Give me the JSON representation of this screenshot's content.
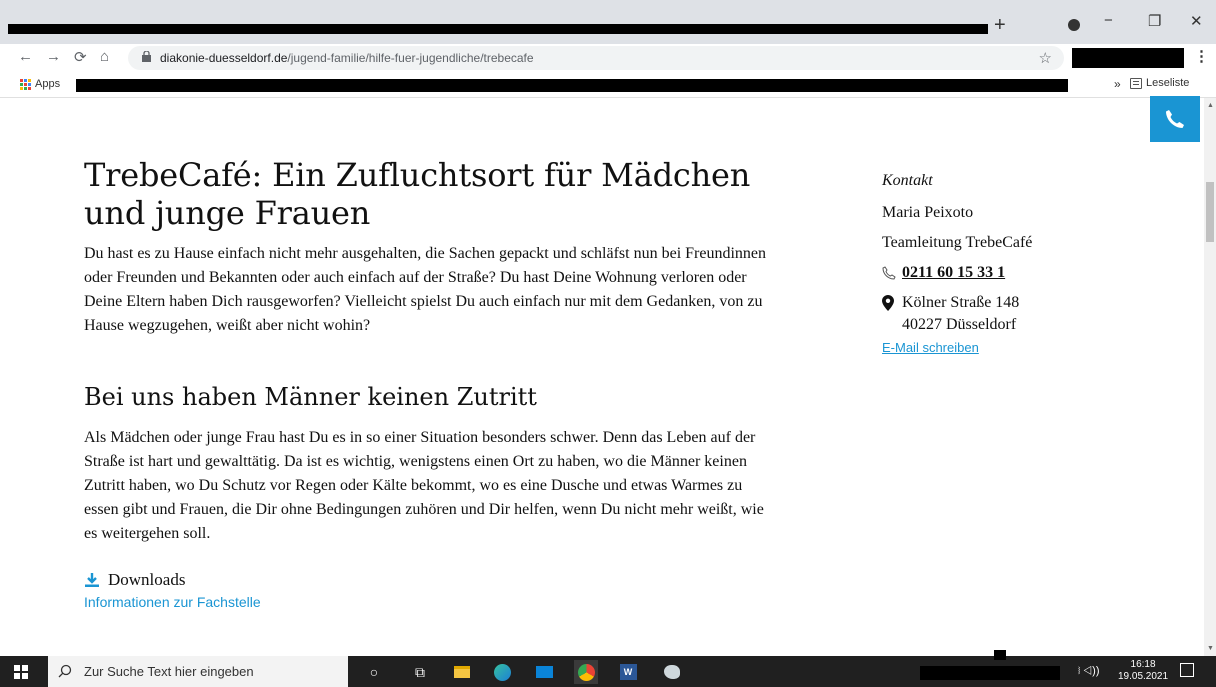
{
  "browser": {
    "new_tab_symbol": "+",
    "minimize_symbol": "−",
    "restore_symbol": "❐",
    "close_symbol": "✕",
    "url_domain": "diakonie-duesseldorf.de",
    "url_path": "/jugend-familie/hilfe-fuer-jugendliche/trebecafe",
    "bookmarks_apps_label": "Apps",
    "bookmarks_more": "»",
    "reading_list_label": "Leseliste"
  },
  "page": {
    "title": "TrebeCafé: Ein Zufluchtsort für Mädchen und junge Frauen",
    "intro": "Du hast es zu  Hause einfach nicht mehr ausgehalten, die Sachen gepackt und schläfst nun bei Freundinnen oder Freunden und Bekannten oder auch einfach auf der Straße? Du hast Deine Wohnung verloren oder Deine Eltern haben Dich rausgeworfen? Vielleicht spielst Du auch einfach nur mit dem Gedanken, von zu Hause wegzugehen, weißt aber nicht wohin?",
    "subheading": "Bei uns haben Männer keinen Zutritt",
    "paragraph2": "Als Mädchen oder junge Frau hast Du es in so einer Situation besonders schwer. Denn das Leben auf der Straße ist hart und gewalttätig. Da ist es wichtig, wenigstens einen Ort zu haben, wo die Männer keinen Zutritt haben, wo Du Schutz vor Regen oder Kälte bekommt, wo es eine Dusche und etwas Warmes zu essen gibt und Frauen, die Dir ohne Bedingungen zuhören und Dir helfen, wenn Du nicht mehr weißt, wie es weitergehen soll.",
    "downloads_label": "Downloads",
    "download_link": "Informationen zur Fachstelle"
  },
  "contact": {
    "heading": "Kontakt",
    "name": "Maria Peixoto",
    "role": "Teamleitung TrebeCafé",
    "phone": "0211 60 15 33 1",
    "street": "Kölner Straße 148",
    "city": "40227 Düsseldorf",
    "email_link": "E-Mail schreiben"
  },
  "taskbar": {
    "search_placeholder": "Zur Suche Text hier eingeben",
    "time": "16:18",
    "date": "19.05.2021"
  },
  "colors": {
    "accent": "#1a95d3",
    "chrome_bg": "#dee1e6",
    "taskbar_bg": "#202020"
  }
}
